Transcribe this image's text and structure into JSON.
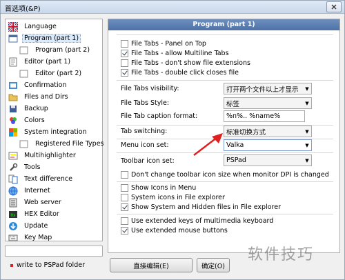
{
  "window": {
    "title": "首选项(&P)"
  },
  "sidebar": {
    "items": [
      {
        "label": "Language",
        "icon": "uk-flag-icon",
        "indent": 0
      },
      {
        "label": "Program  (part 1)",
        "icon": "program-window-icon",
        "indent": 0,
        "selected": true
      },
      {
        "label": "Program  (part 2)",
        "icon": "",
        "indent": 1
      },
      {
        "label": "Editor  (part 1)",
        "icon": "editor-page-icon",
        "indent": 0
      },
      {
        "label": "Editor  (part 2)",
        "icon": "",
        "indent": 1
      },
      {
        "label": "Confirmation",
        "icon": "confirmation-icon",
        "indent": 0
      },
      {
        "label": "Files and Dirs",
        "icon": "folder-icon",
        "indent": 0
      },
      {
        "label": "Backup",
        "icon": "backup-icon",
        "indent": 0
      },
      {
        "label": "Colors",
        "icon": "colors-icon",
        "indent": 0
      },
      {
        "label": "System integration",
        "icon": "system-integration-icon",
        "indent": 0
      },
      {
        "label": "Registered File Types",
        "icon": "",
        "indent": 1
      },
      {
        "label": "Multihighlighter",
        "icon": "multihighlighter-icon",
        "indent": 0
      },
      {
        "label": "Tools",
        "icon": "tools-icon",
        "indent": 0
      },
      {
        "label": "Text difference",
        "icon": "text-difference-icon",
        "indent": 0
      },
      {
        "label": "Internet",
        "icon": "internet-icon",
        "indent": 0
      },
      {
        "label": "Web server",
        "icon": "web-server-icon",
        "indent": 0
      },
      {
        "label": "HEX Editor",
        "icon": "hex-editor-icon",
        "indent": 0
      },
      {
        "label": "Update",
        "icon": "update-icon",
        "indent": 0
      },
      {
        "label": "Key Map",
        "icon": "key-map-icon",
        "indent": 0
      }
    ],
    "write_label": "write to PSPad folder"
  },
  "panel": {
    "header": "Program (part 1)",
    "checkboxes_group1": [
      {
        "label": "File Tabs - Panel on Top",
        "checked": false
      },
      {
        "label": "File Tabs - allow Multiline Tabs",
        "checked": true
      },
      {
        "label": "File Tabs - don't show file extensions",
        "checked": false
      },
      {
        "label": "File Tabs - double click closes file",
        "checked": true
      }
    ],
    "file_tabs_visibility": {
      "label": "File Tabs visibility:",
      "value": "打开两个文件以上才显示"
    },
    "file_tabs_style": {
      "label": "File Tabs Style:",
      "value": "标签"
    },
    "file_tab_caption_format": {
      "label": "File Tab caption format:",
      "value": "%n%.. %name%"
    },
    "tab_switching": {
      "label": "Tab switching:",
      "value": "标准切换方式"
    },
    "menu_icon_set": {
      "label": "Menu icon set:",
      "value": "Valka"
    },
    "toolbar_icon_set": {
      "label": "Toolbar icon set:",
      "value": "PSPad"
    },
    "checkboxes_group2": [
      {
        "label": "Don't change toolbar icon size when monitor DPI is changed",
        "checked": false
      },
      {
        "label": "Show Icons in Menu",
        "checked": false
      },
      {
        "label": "System icons in File explorer",
        "checked": false
      },
      {
        "label": "Show System and Hidden files in File explorer",
        "checked": true
      },
      {
        "label": "Use extended keys of multimedia keyboard",
        "checked": false
      },
      {
        "label": "Use extended mouse buttons",
        "checked": true
      }
    ]
  },
  "buttons": {
    "edit_directly": "直接编辑(E)",
    "ok": "确定(O)"
  },
  "watermark": "软件技巧",
  "colors": {
    "header_bg": "#5a7db0",
    "annotation_arrow": "#e02020"
  }
}
